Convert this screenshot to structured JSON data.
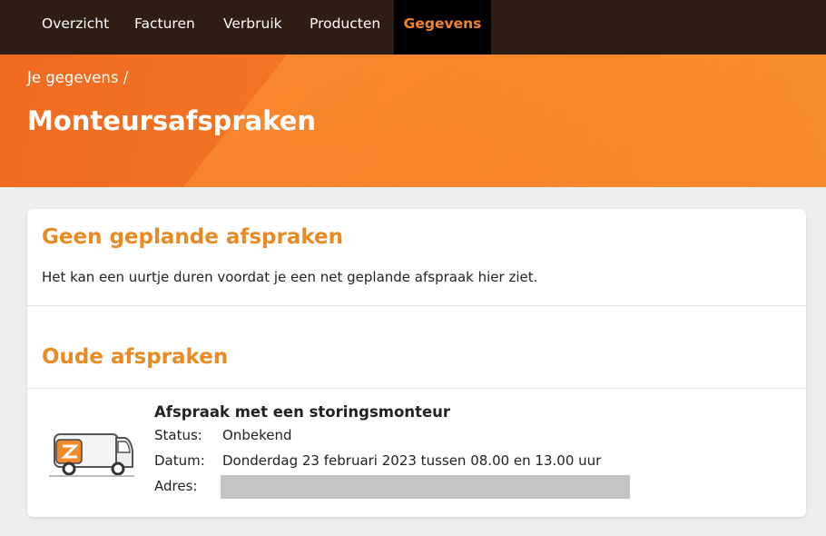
{
  "nav": {
    "items": [
      {
        "label": "Overzicht"
      },
      {
        "label": "Facturen"
      },
      {
        "label": "Verbruik"
      },
      {
        "label": "Producten"
      },
      {
        "label": "Gegevens",
        "active": true
      }
    ]
  },
  "hero": {
    "breadcrumb": "Je gegevens /",
    "title": "Monteursafspraken"
  },
  "planned": {
    "heading": "Geen geplande afspraken",
    "message": "Het kan een uurtje duren voordat je een net geplande afspraak hier ziet."
  },
  "past": {
    "heading": "Oude afspraken",
    "appointment": {
      "title": "Afspraak met een storingsmonteur",
      "status_label": "Status:",
      "status_value": "Onbekend",
      "date_label": "Datum:",
      "date_value": "Donderdag 23 februari 2023 tussen 08.00 en 13.00 uur",
      "address_label": "Adres:",
      "icon": "service-van-icon"
    }
  },
  "colors": {
    "nav_bg": "#2e1d12",
    "accent": "#f2852a",
    "heading": "#e98b22",
    "hero": "#f27a24"
  }
}
